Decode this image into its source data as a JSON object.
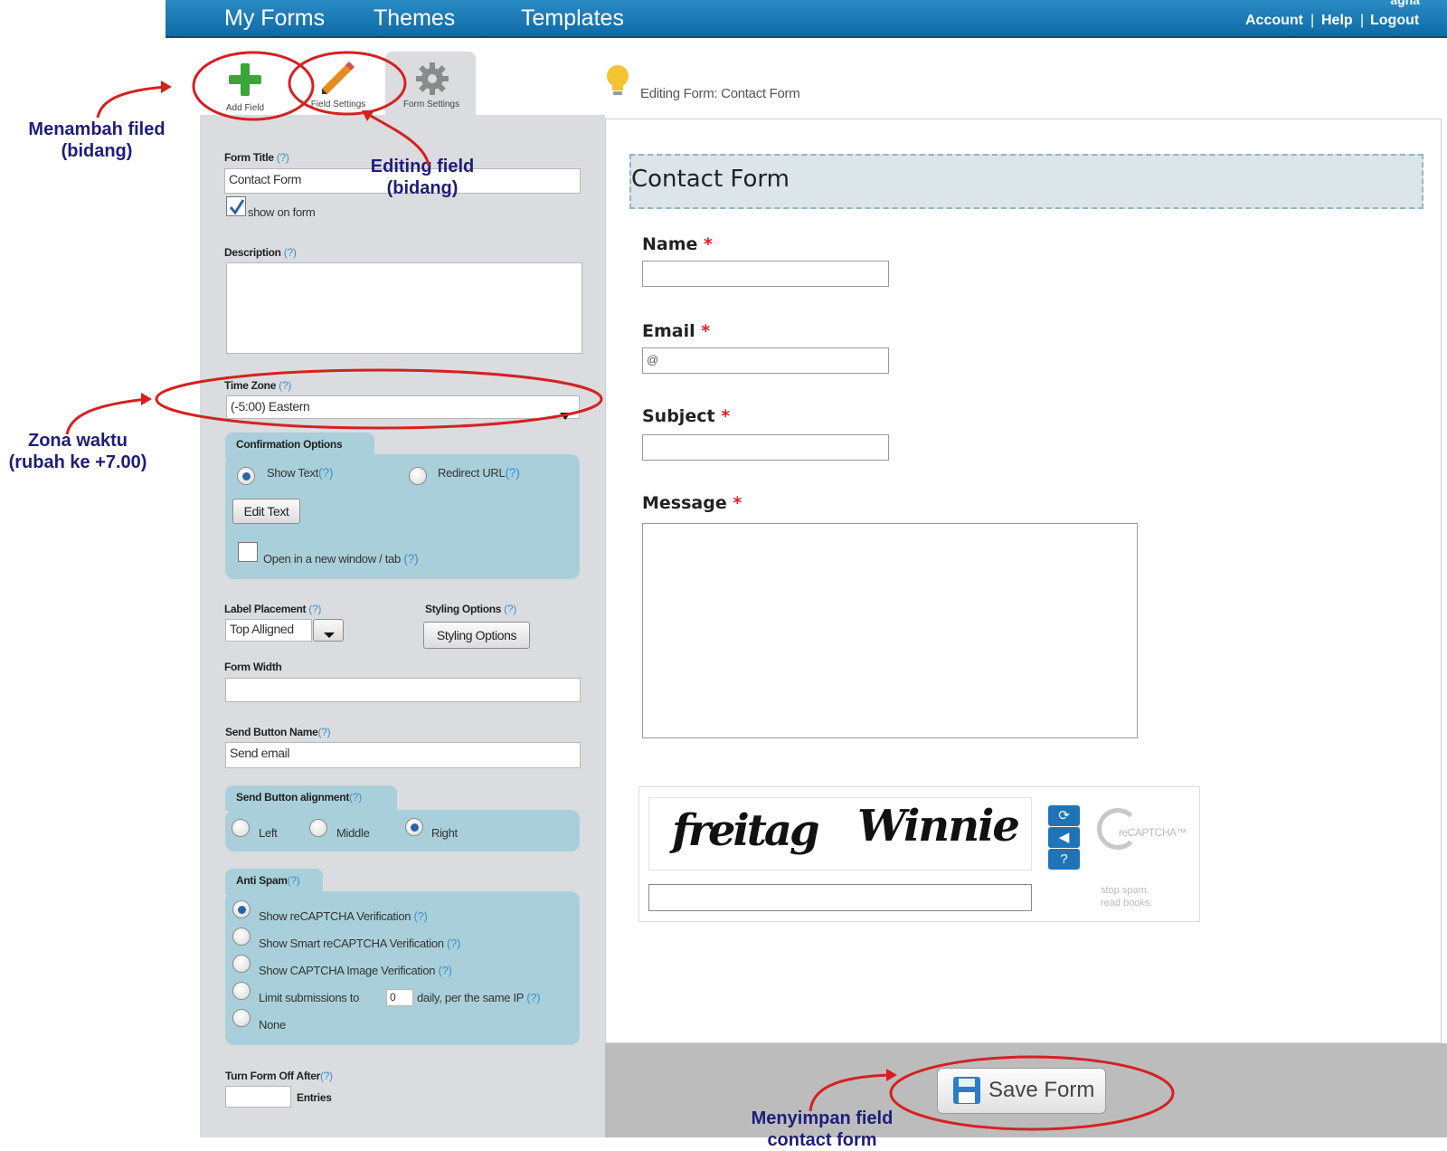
{
  "nav": {
    "items": [
      "My Forms",
      "Themes",
      "Templates"
    ],
    "account": "Account",
    "help": "Help",
    "logout": "Logout",
    "sep": "|",
    "username": "agha"
  },
  "tabs": {
    "add_field": "Add Field",
    "field_settings": "Field Settings",
    "form_settings": "Form Settings"
  },
  "editing_header": "Editing Form: Contact Form",
  "settings": {
    "help": "(?)",
    "form_title_label": "Form Title",
    "form_title_value": "Contact Form",
    "show_on_form": "show on form",
    "description_label": "Description",
    "time_zone_label": "Time Zone",
    "time_zone_value": "(-5:00) Eastern",
    "confirmation_label": "Confirmation Options",
    "show_text": "Show Text",
    "redirect_url": "Redirect URL",
    "edit_text": "Edit Text",
    "open_new_window": "Open in a new window / tab",
    "label_placement_label": "Label Placement",
    "label_placement_value": "Top Alligned",
    "styling_options_label": "Styling Options",
    "styling_options_button": "Styling Options",
    "form_width_label": "Form Width",
    "send_button_name_label": "Send Button Name",
    "send_button_name_value": "Send email",
    "send_alignment_label": "Send Button alignment",
    "align_left": "Left",
    "align_middle": "Middle",
    "align_right": "Right",
    "anti_spam_label": "Anti Spam",
    "spam_options": [
      "Show reCAPTCHA Verification",
      "Show Smart reCAPTCHA Verification",
      "Show CAPTCHA Image Verification",
      "Limit submissions to",
      "None"
    ],
    "limit_value": "0",
    "limit_suffix": "daily, per the same IP",
    "turn_off_label": "Turn Form Off After",
    "entries": "Entries"
  },
  "form": {
    "title": "Contact Form",
    "required_mark": "*",
    "fields": [
      "Name",
      "Email",
      "Subject",
      "Message"
    ],
    "email_placeholder_icon": "@"
  },
  "captcha": {
    "word1": "freitag",
    "word2": "Winnie",
    "logo": "reCAPTCHA™",
    "tagline1": "stop spam.",
    "tagline2": "read books."
  },
  "save_button": "Save Form",
  "annotations": {
    "add_field": "Menambah filed\n(bidang)",
    "editing_field": "Editing field\n(bidang)",
    "time_zone": "Zona waktu\n(rubah ke +7.00)",
    "save": "Menyimpan field\ncontact form"
  },
  "colors": {
    "nav": "#1a7ab8",
    "annotation_red": "#d62020",
    "annotation_text": "#1f1d7a",
    "group_bg": "#a9d0da"
  }
}
